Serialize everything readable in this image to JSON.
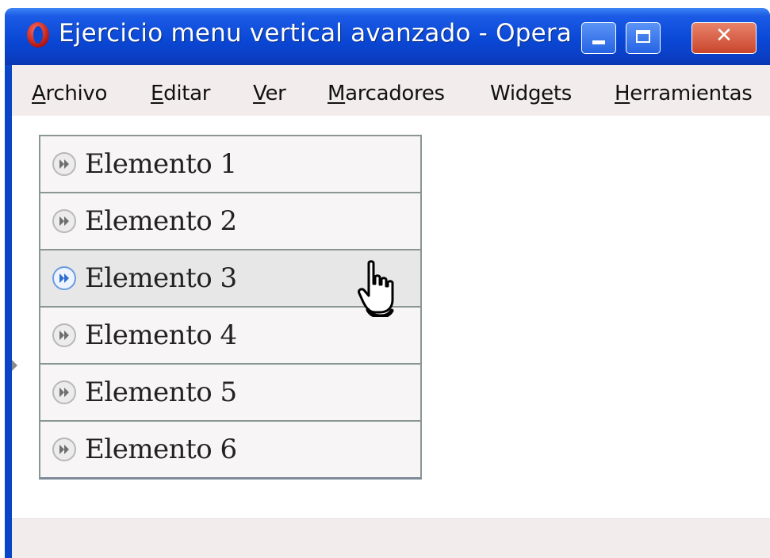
{
  "window": {
    "title": "Ejercicio menu vertical avanzado - Opera",
    "controls": {
      "minimize_icon": "minimize-icon",
      "maximize_icon": "maximize-icon",
      "close_icon": "close-icon",
      "close_glyph": "✕"
    }
  },
  "menubar": {
    "items": [
      {
        "accel": "A",
        "rest": "rchivo"
      },
      {
        "accel": "E",
        "rest": "ditar"
      },
      {
        "accel": "V",
        "rest": "er"
      },
      {
        "accel": "M",
        "rest": "arcadores"
      },
      {
        "pre": "Widg",
        "accel": "e",
        "rest": "ts"
      },
      {
        "accel": "H",
        "rest": "erramientas"
      }
    ]
  },
  "vertical_menu": {
    "items": [
      {
        "label": "Elemento 1",
        "icon": "forward-arrows-icon",
        "hovered": false
      },
      {
        "label": "Elemento 2",
        "icon": "forward-arrows-icon",
        "hovered": false
      },
      {
        "label": "Elemento 3",
        "icon": "forward-arrows-icon",
        "hovered": true
      },
      {
        "label": "Elemento 4",
        "icon": "forward-arrows-icon",
        "hovered": false
      },
      {
        "label": "Elemento 5",
        "icon": "forward-arrows-icon",
        "hovered": false
      },
      {
        "label": "Elemento 6",
        "icon": "forward-arrows-icon",
        "hovered": false
      }
    ]
  },
  "colors": {
    "titlebar": "#0a48d6",
    "chrome": "#f3ecec",
    "menu_border": "#8a9693",
    "hover_bg": "#e7e7e7",
    "close_button": "#c9452c"
  },
  "cursor": "hand-pointer-icon"
}
